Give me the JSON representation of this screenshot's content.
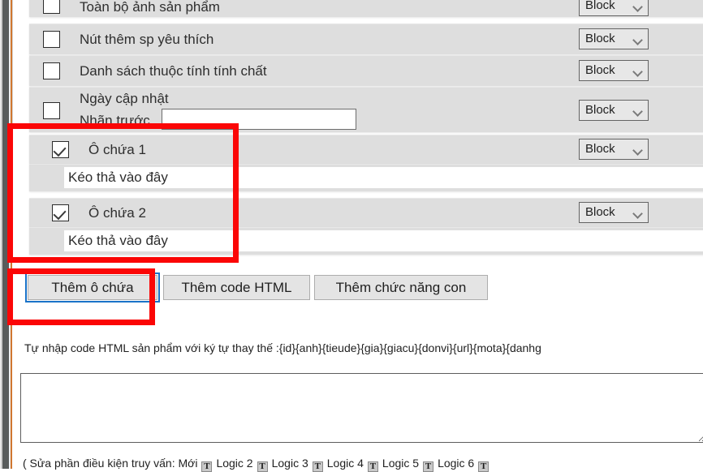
{
  "accent": {
    "annotation_red": "#fb0606",
    "focus_blue": "#1a73c8",
    "rule_orange": "#d0772f",
    "row_gray": "#dedede"
  },
  "list": {
    "rows": [
      {
        "label": "Toàn bộ ảnh sản phẩm",
        "checked": false,
        "display_mode": "Block",
        "kind": "simple"
      },
      {
        "label": "Nút thêm sp yêu thích",
        "checked": false,
        "display_mode": "Block",
        "kind": "simple"
      },
      {
        "label": "Danh sách thuộc tính tính chất",
        "checked": false,
        "display_mode": "Block",
        "kind": "simple"
      },
      {
        "label": "Ngày cập nhật",
        "sub_label": "Nhãn trước",
        "input_value": "",
        "checked": false,
        "display_mode": "Block",
        "kind": "labeled-input"
      },
      {
        "label": "Ô chứa 1",
        "checked": true,
        "display_mode": "Block",
        "dropzone": "Kéo thả vào đây",
        "kind": "container"
      },
      {
        "label": "Ô chứa 2",
        "checked": true,
        "display_mode": "Block",
        "dropzone": "Kéo thả vào đây",
        "kind": "container"
      }
    ]
  },
  "buttons": {
    "add_container": "Thêm ô chứa",
    "add_html_code": "Thêm code HTML",
    "add_sub_feature": "Thêm chức năng con"
  },
  "code_section": {
    "hint": "Tự nhập code HTML sản phẩm với ký tự thay thế :{id}{anh}{tieude}{gia}{giacu}{donvi}{url}{mota}{danhg",
    "textarea_value": "",
    "textarea_placeholder": ""
  },
  "footer": {
    "prefix": "( Sửa phần điều kiện truy vấn: Mới",
    "glyph": "T",
    "links": [
      "Logic 2",
      "Logic 3",
      "Logic 4",
      "Logic 5",
      "Logic 6"
    ]
  }
}
